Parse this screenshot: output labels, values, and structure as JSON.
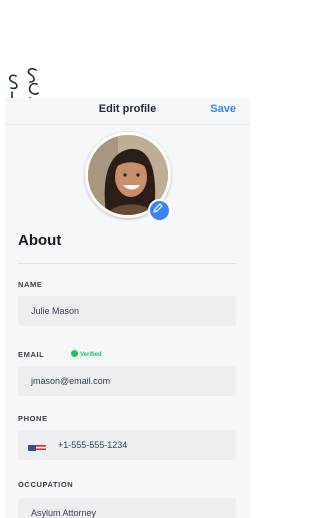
{
  "header": {
    "title": "Edit profile",
    "save_label": "Save"
  },
  "section": {
    "title": "About"
  },
  "fields": {
    "name": {
      "label": "NAME",
      "value": "Julie Mason"
    },
    "email": {
      "label": "EMAIL",
      "value": "jmason@email.com",
      "verified_label": "Verified"
    },
    "phone": {
      "label": "PHONE",
      "value": "+1-555-555-1234",
      "flag": "us-flag-icon"
    },
    "occupation": {
      "label": "OCCUPATION",
      "value": "Asylum Attorney"
    }
  },
  "colors": {
    "accent": "#3b82f6",
    "verified": "#22c55e",
    "background": "#f6f7f9",
    "field": "#eceef1"
  }
}
